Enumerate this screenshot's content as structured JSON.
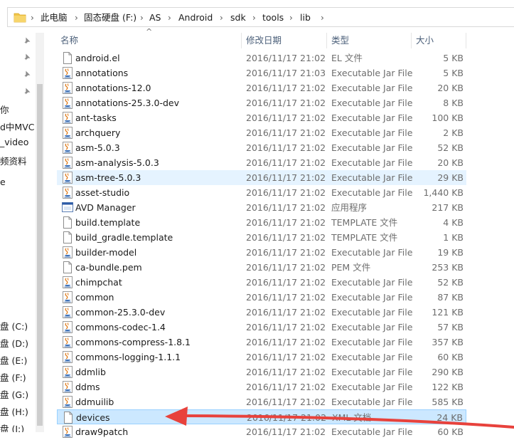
{
  "breadcrumb": [
    "此电脑",
    "固态硬盘 (F:)",
    "AS",
    "Android",
    "sdk",
    "tools",
    "lib"
  ],
  "nav": {
    "items": [
      "你",
      "d中MVC",
      "_video",
      "频资料",
      "e",
      "盘 (C:)",
      "盘 (D:)",
      "盘 (E:)",
      "盘 (F:)",
      "盘 (G:)",
      "盘 (H:)",
      "盘 (I:)"
    ]
  },
  "columns": {
    "name": "名称",
    "date": "修改日期",
    "type": "类型",
    "size": "大小"
  },
  "colors": {
    "accent_arrow": "#e8423c",
    "selection": "#cce8ff",
    "hover": "#e5f3ff",
    "header_text": "#4c607a"
  },
  "files": [
    {
      "name": "android.el",
      "date": "2016/11/17 21:02",
      "type": "EL 文件",
      "size": "5 KB",
      "icon": "file-icon"
    },
    {
      "name": "annotations",
      "date": "2016/11/17 21:03",
      "type": "Executable Jar File",
      "size": "5 KB",
      "icon": "jar-icon"
    },
    {
      "name": "annotations-12.0",
      "date": "2016/11/17 21:02",
      "type": "Executable Jar File",
      "size": "20 KB",
      "icon": "jar-icon"
    },
    {
      "name": "annotations-25.3.0-dev",
      "date": "2016/11/17 21:02",
      "type": "Executable Jar File",
      "size": "8 KB",
      "icon": "jar-icon"
    },
    {
      "name": "ant-tasks",
      "date": "2016/11/17 21:02",
      "type": "Executable Jar File",
      "size": "100 KB",
      "icon": "jar-icon"
    },
    {
      "name": "archquery",
      "date": "2016/11/17 21:02",
      "type": "Executable Jar File",
      "size": "2 KB",
      "icon": "jar-icon"
    },
    {
      "name": "asm-5.0.3",
      "date": "2016/11/17 21:02",
      "type": "Executable Jar File",
      "size": "52 KB",
      "icon": "jar-icon"
    },
    {
      "name": "asm-analysis-5.0.3",
      "date": "2016/11/17 21:02",
      "type": "Executable Jar File",
      "size": "20 KB",
      "icon": "jar-icon"
    },
    {
      "name": "asm-tree-5.0.3",
      "date": "2016/11/17 21:02",
      "type": "Executable Jar File",
      "size": "29 KB",
      "icon": "jar-icon"
    },
    {
      "name": "asset-studio",
      "date": "2016/11/17 21:02",
      "type": "Executable Jar File",
      "size": "1,440 KB",
      "icon": "jar-icon"
    },
    {
      "name": "AVD Manager",
      "date": "2016/11/17 21:02",
      "type": "应用程序",
      "size": "217 KB",
      "icon": "app-icon"
    },
    {
      "name": "build.template",
      "date": "2016/11/17 21:02",
      "type": "TEMPLATE 文件",
      "size": "4 KB",
      "icon": "file-icon"
    },
    {
      "name": "build_gradle.template",
      "date": "2016/11/17 21:02",
      "type": "TEMPLATE 文件",
      "size": "1 KB",
      "icon": "file-icon"
    },
    {
      "name": "builder-model",
      "date": "2016/11/17 21:02",
      "type": "Executable Jar File",
      "size": "19 KB",
      "icon": "jar-icon"
    },
    {
      "name": "ca-bundle.pem",
      "date": "2016/11/17 21:02",
      "type": "PEM 文件",
      "size": "253 KB",
      "icon": "file-icon"
    },
    {
      "name": "chimpchat",
      "date": "2016/11/17 21:02",
      "type": "Executable Jar File",
      "size": "52 KB",
      "icon": "jar-icon"
    },
    {
      "name": "common",
      "date": "2016/11/17 21:02",
      "type": "Executable Jar File",
      "size": "87 KB",
      "icon": "jar-icon"
    },
    {
      "name": "common-25.3.0-dev",
      "date": "2016/11/17 21:02",
      "type": "Executable Jar File",
      "size": "121 KB",
      "icon": "jar-icon"
    },
    {
      "name": "commons-codec-1.4",
      "date": "2016/11/17 21:02",
      "type": "Executable Jar File",
      "size": "57 KB",
      "icon": "jar-icon"
    },
    {
      "name": "commons-compress-1.8.1",
      "date": "2016/11/17 21:02",
      "type": "Executable Jar File",
      "size": "357 KB",
      "icon": "jar-icon"
    },
    {
      "name": "commons-logging-1.1.1",
      "date": "2016/11/17 21:02",
      "type": "Executable Jar File",
      "size": "60 KB",
      "icon": "jar-icon"
    },
    {
      "name": "ddmlib",
      "date": "2016/11/17 21:02",
      "type": "Executable Jar File",
      "size": "290 KB",
      "icon": "jar-icon"
    },
    {
      "name": "ddms",
      "date": "2016/11/17 21:02",
      "type": "Executable Jar File",
      "size": "122 KB",
      "icon": "jar-icon"
    },
    {
      "name": "ddmuilib",
      "date": "2016/11/17 21:02",
      "type": "Executable Jar File",
      "size": "585 KB",
      "icon": "jar-icon"
    },
    {
      "name": "devices",
      "date": "2016/11/17 21:02",
      "type": "XML 文档",
      "size": "24 KB",
      "icon": "file-icon"
    },
    {
      "name": "draw9patch",
      "date": "2016/11/17 21:02",
      "type": "Executable Jar File",
      "size": "60 KB",
      "icon": "jar-icon"
    }
  ]
}
